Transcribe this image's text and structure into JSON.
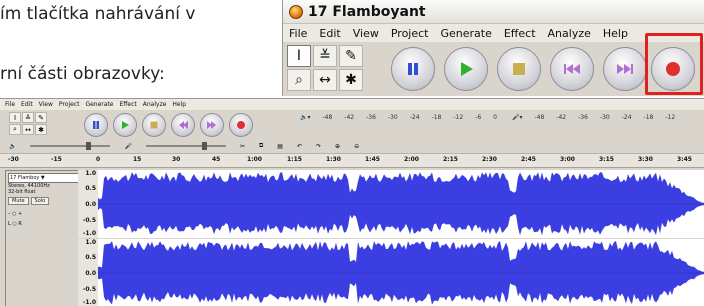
{
  "instructions": {
    "line1": "ím tlačítka nahrávání v",
    "line2": "",
    "line3": "rní části obrazovky:"
  },
  "zoom": {
    "title": "17 Flamboyant",
    "menu": [
      "File",
      "Edit",
      "View",
      "Project",
      "Generate",
      "Effect",
      "Analyze",
      "Help"
    ],
    "tools": [
      "I",
      "≚",
      "✎",
      "⌕",
      "↔",
      "✱"
    ],
    "transport": [
      "pause-icon",
      "play-icon",
      "stop-icon",
      "skip-start-icon",
      "skip-end-icon",
      "record-icon"
    ],
    "highlight_color": "#e02020"
  },
  "shot": {
    "menu": [
      "File",
      "Edit",
      "View",
      "Project",
      "Generate",
      "Effect",
      "Analyze",
      "Help"
    ],
    "meter_left": [
      "-48",
      "-42",
      "-36",
      "-30",
      "-24",
      "-18",
      "-12",
      "-6",
      "0"
    ],
    "meter_right": [
      "-48",
      "-42",
      "-36",
      "-30",
      "-24",
      "-18",
      "-12"
    ],
    "ruler": [
      "-30",
      "-15",
      "0",
      "15",
      "30",
      "45",
      "1:00",
      "1:15",
      "1:30",
      "1:45",
      "2:00",
      "2:15",
      "2:30",
      "2:45",
      "3:00",
      "3:15",
      "3:30",
      "3:45"
    ],
    "track": {
      "name": "17 Flamboy ▼",
      "info1": "Stereo, 44100Hz",
      "info2": "32-bit float",
      "mute": "Mute",
      "solo": "Solo",
      "left": "L",
      "right": "R"
    },
    "scale_top": [
      "1.0",
      "0.5",
      "0.0",
      "-0.5",
      "-1.0"
    ],
    "scale_bottom": [
      "1.0",
      "0.5",
      "0.0",
      "-0.5",
      "-1.0"
    ],
    "wave_color": "#3b3ee0"
  }
}
